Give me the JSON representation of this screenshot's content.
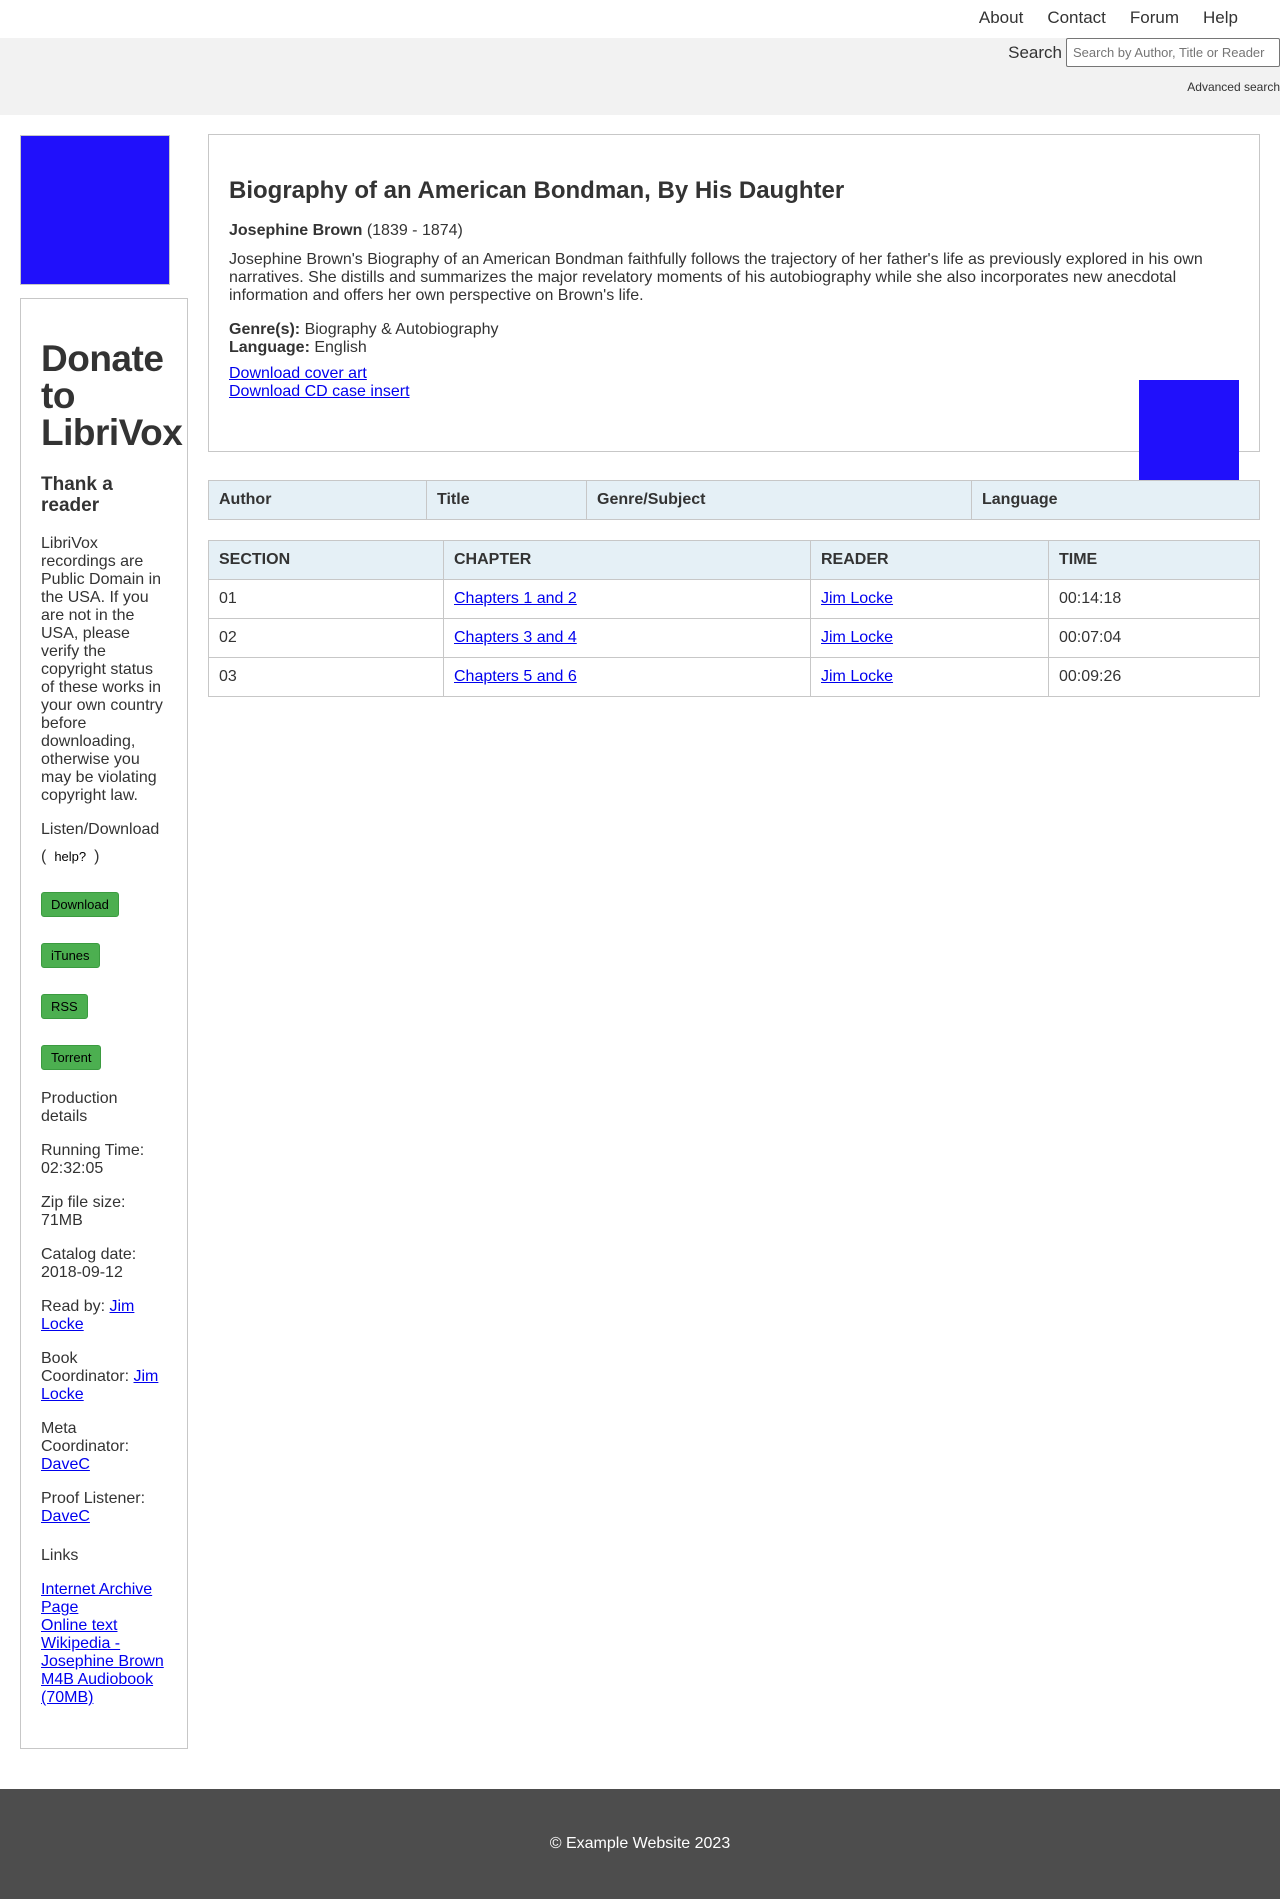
{
  "nav": {
    "items": [
      "About",
      "Contact",
      "Forum",
      "Help"
    ]
  },
  "search": {
    "label": "Search",
    "placeholder": "Search by Author, Title or Reader",
    "advanced": "Advanced search"
  },
  "sidebar": {
    "cover_color": "#2010fb",
    "donate_title": "Donate to LibriVox",
    "thank_heading": "Thank a reader",
    "notice": "LibriVox recordings are Public Domain in the USA. If you are not in the USA, please verify the copyright status of these works in your own country before downloading, otherwise you may be violating copyright law.",
    "listen_label": "Listen/Download",
    "help_open": "(",
    "help_label": "help?",
    "help_close": ")",
    "buttons": {
      "download": "Download",
      "itunes": "iTunes",
      "rss": "RSS",
      "torrent": "Torrent"
    },
    "production_details": "Production details",
    "running_time_label": "Running Time:",
    "running_time": "02:32:05",
    "zip_label": "Zip file size:",
    "zip_size": "71MB",
    "catalog_label": "Catalog date:",
    "catalog_date": "2018-09-12",
    "read_by_label": "Read by:",
    "read_by": "Jim Locke",
    "book_coord_label": "Book Coordinator:",
    "book_coord": "Jim Locke",
    "meta_coord_label": "Meta Coordinator:",
    "meta_coord": "DaveC",
    "proof_label": "Proof Listener:",
    "proof": "DaveC",
    "links_heading": "Links",
    "links": {
      "archive": "Internet Archive Page",
      "online_text": "Online text",
      "wikipedia": "Wikipedia - Josephine Brown",
      "m4b": "M4B Audiobook (70MB)"
    }
  },
  "book": {
    "title": "Biography of an American Bondman, By His Daughter",
    "author": "Josephine Brown",
    "dates": "(1839 - 1874)",
    "description": "Josephine Brown's Biography of an American Bondman faithfully follows the trajectory of her father's life as previously explored in his own narratives. She distills and summarizes the major revelatory moments of his autobiography while she also incorporates new anecdotal information and offers her own perspective on Brown's life.",
    "genre_label": "Genre(s):",
    "genre": "Biography & Autobiography",
    "language_label": "Language:",
    "language": "English",
    "download_cover": "Download cover art",
    "download_cd": "Download CD case insert",
    "cd_color": "#2010fb"
  },
  "info_table": {
    "headers": [
      "Author",
      "Title",
      "Genre/Subject",
      "Language"
    ]
  },
  "sections": {
    "headers": [
      "SECTION",
      "CHAPTER",
      "READER",
      "TIME"
    ],
    "rows": [
      {
        "section": "01",
        "chapter": "Chapters 1 and 2",
        "reader": "Jim Locke",
        "time": "00:14:18"
      },
      {
        "section": "02",
        "chapter": "Chapters 3 and 4",
        "reader": "Jim Locke",
        "time": "00:07:04"
      },
      {
        "section": "03",
        "chapter": "Chapters 5 and 6",
        "reader": "Jim Locke",
        "time": "00:09:26"
      }
    ]
  },
  "footer": {
    "text": "© Example Website 2023"
  }
}
